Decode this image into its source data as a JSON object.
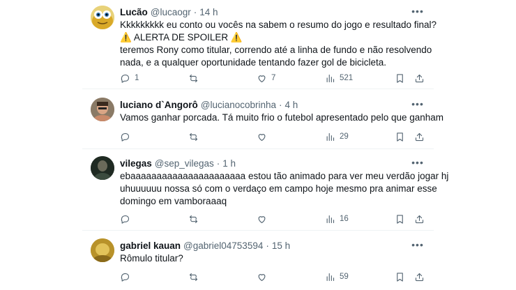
{
  "tweets": [
    {
      "name": "Lucão",
      "handle": "@lucaogr",
      "time": "14 h",
      "lines": [
        "Kkkkkkkkk eu conto ou vocês na sabem o resumo do jogo e resultado final?",
        "⚠️ ALERTA DE SPOILER ⚠️",
        "teremos Rony como titular, correndo até a linha de fundo e não resolvendo",
        "nada, e a qualquer oportunidade tentando fazer gol de bicicleta."
      ],
      "replies": "1",
      "retweets": "",
      "likes": "7",
      "views": "521",
      "avatar_color": "#e0b64a"
    },
    {
      "name": "luciano d`Angorô",
      "handle": "@lucianocobrinha",
      "time": "4 h",
      "lines": [
        "Vamos ganhar porcada. Tá muito frio o futebol apresentado pelo que ganham"
      ],
      "replies": "",
      "retweets": "",
      "likes": "",
      "views": "29",
      "avatar_color": "#b08a6a"
    },
    {
      "name": "vilegas",
      "handle": "@sep_vilegas",
      "time": "1 h",
      "lines": [
        "ebaaaaaaaaaaaaaaaaaaaaaa estou tão animado para ver meu verdão jogar hj",
        "uhuuuuuu nossa só com o verdaço em campo hoje mesmo pra animar esse",
        "domingo em vamboraaaq"
      ],
      "replies": "",
      "retweets": "",
      "likes": "",
      "views": "16",
      "avatar_color": "#2b3a2e"
    },
    {
      "name": "gabriel kauan",
      "handle": "@gabriel04753594",
      "time": "15 h",
      "lines": [
        "Rômulo titular?"
      ],
      "replies": "",
      "retweets": "",
      "likes": "",
      "views": "59",
      "avatar_color": "#c9a233"
    }
  ]
}
